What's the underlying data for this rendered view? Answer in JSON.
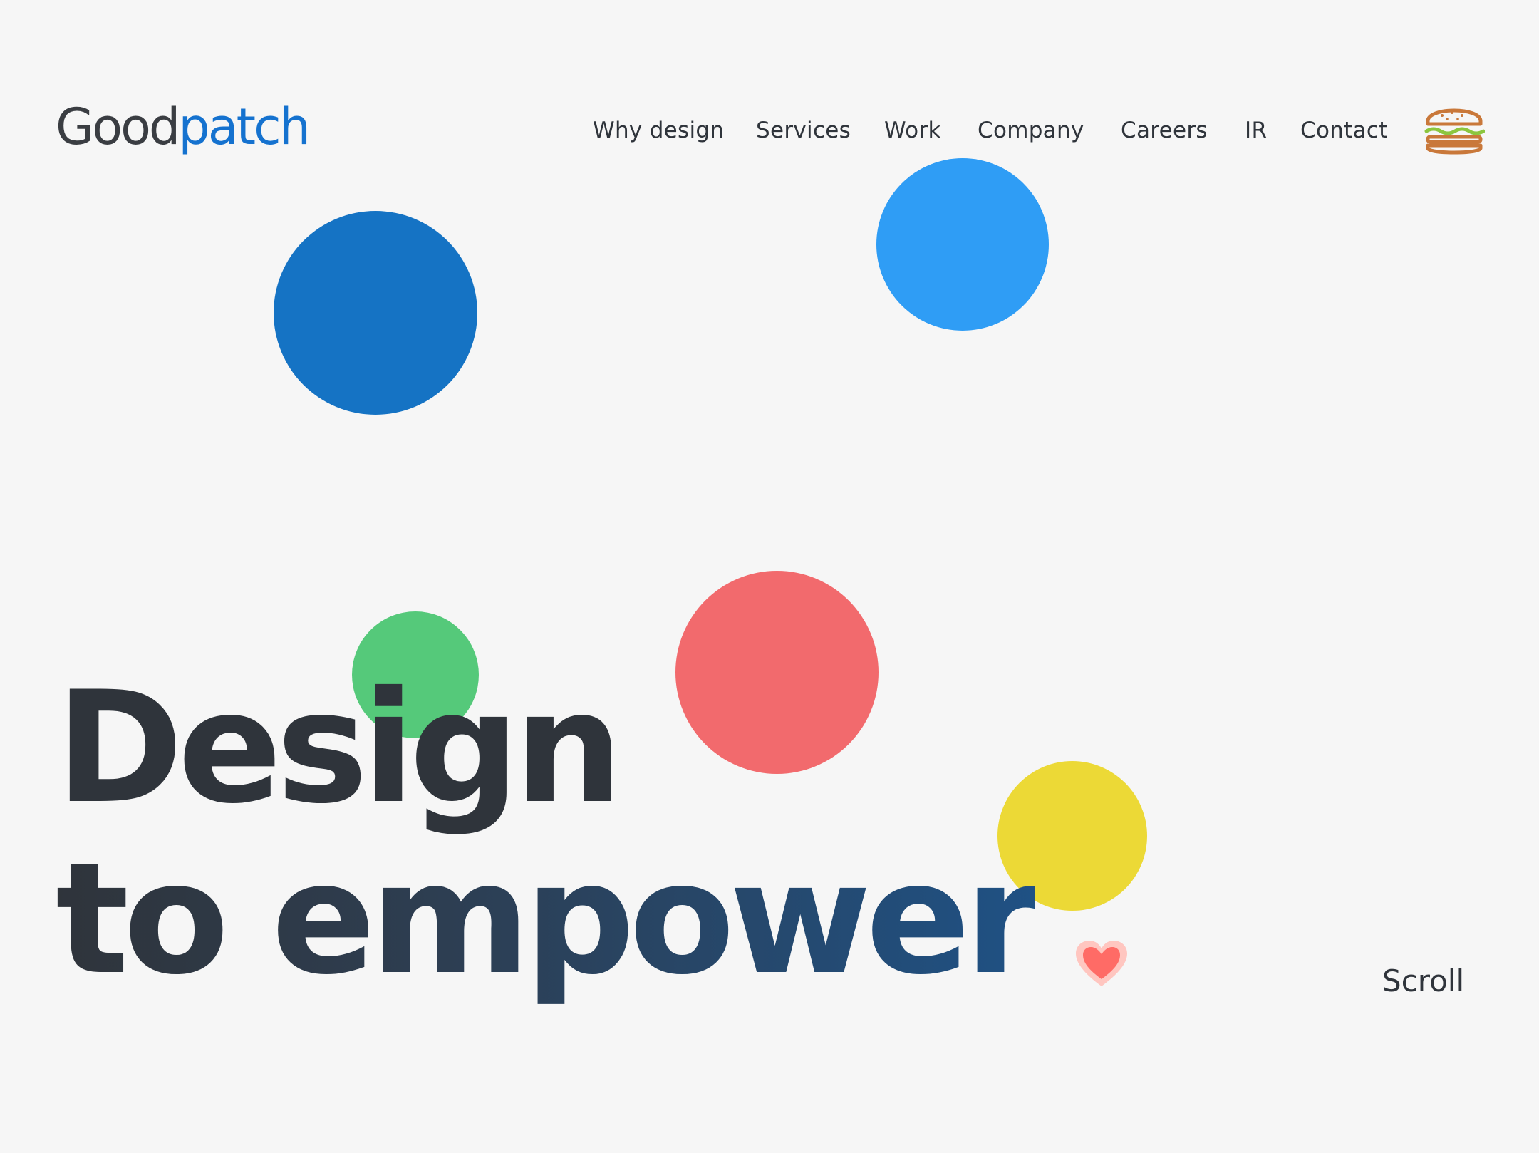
{
  "brand": {
    "logo_part1": "Good",
    "logo_part2": "patch",
    "colors": {
      "text": "#3a3d42",
      "accent": "#1572cf"
    }
  },
  "nav": {
    "items": [
      {
        "label": "Why design"
      },
      {
        "label": "Services"
      },
      {
        "label": "Work"
      },
      {
        "label": "Company"
      },
      {
        "label": "Careers"
      },
      {
        "label": "IR"
      },
      {
        "label": "Contact"
      }
    ],
    "menu_icon": "hamburger-icon",
    "menu_icon_color": "#c9783a"
  },
  "hero": {
    "headline_line1": "Design",
    "headline_line2": "to empower",
    "heart_icon": "heart-icon",
    "heart_color": "#ff6b66",
    "bubbles": [
      {
        "name": "dark-blue",
        "color": "#1573c4"
      },
      {
        "name": "light-blue",
        "color": "#2f9df5"
      },
      {
        "name": "green",
        "color": "#55c97a"
      },
      {
        "name": "coral",
        "color": "#f26a6d"
      },
      {
        "name": "yellow",
        "color": "#ecd936"
      }
    ]
  },
  "scroll": {
    "label": "Scroll"
  }
}
